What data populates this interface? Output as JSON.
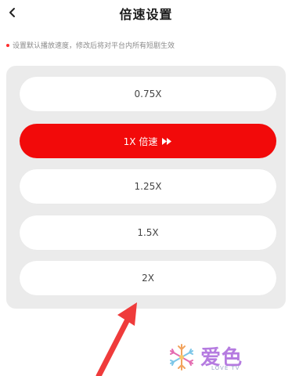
{
  "header": {
    "title": "倍速设置",
    "back_icon": "chevron-left-icon"
  },
  "hint": {
    "text": "设置默认播放速度，修改后将对平台内所有短剧生效",
    "dot_color": "#ff2d2d"
  },
  "speed_options": [
    {
      "label": "0.75X",
      "selected": false
    },
    {
      "label": "1X 倍速",
      "selected": true,
      "icon": "fast-forward-icon"
    },
    {
      "label": "1.25X",
      "selected": false
    },
    {
      "label": "1.5X",
      "selected": false
    },
    {
      "label": "2X",
      "selected": false
    }
  ],
  "colors": {
    "accent": "#f20a0a",
    "panel_bg": "#ebebeb",
    "annotation_arrow": "#ef3b3b"
  },
  "watermark": {
    "logo_text": "爱色",
    "sub_text": "LOVE TV"
  }
}
